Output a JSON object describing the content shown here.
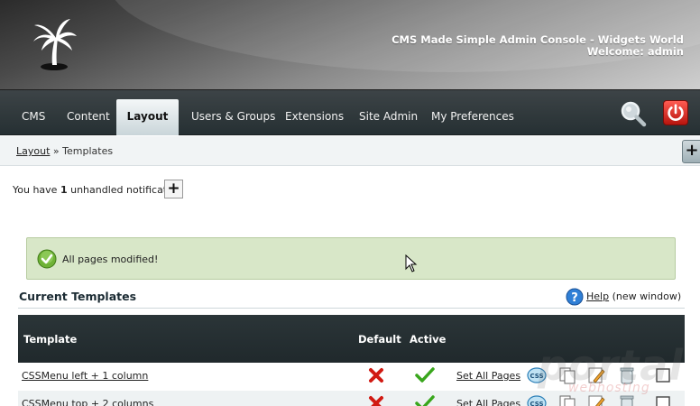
{
  "header": {
    "console_title": "CMS Made Simple Admin Console - Widgets World",
    "welcome": "Welcome: admin",
    "logo_icon": "palm-tree-logo-icon"
  },
  "nav": {
    "items": [
      {
        "label": "CMS",
        "active": false
      },
      {
        "label": "Content",
        "active": false
      },
      {
        "label": "Layout",
        "active": true
      },
      {
        "label": "Users & Groups",
        "active": false
      },
      {
        "label": "Extensions",
        "active": false
      },
      {
        "label": "Site Admin",
        "active": false
      },
      {
        "label": "My Preferences",
        "active": false
      }
    ],
    "search_icon": "magnifier-icon",
    "logout_icon": "power-icon"
  },
  "breadcrumb": {
    "parent": "Layout",
    "separator": "»",
    "current": "Templates",
    "toggle": "+"
  },
  "notification": {
    "prefix": "You have",
    "count": "1",
    "suffix": "unhandled notification",
    "expand": "+"
  },
  "message": {
    "text": "All pages modified!"
  },
  "section": {
    "title": "Current Templates",
    "help_label": "Help",
    "help_note": "(new window)"
  },
  "table": {
    "columns": {
      "template": "Template",
      "default": "Default",
      "active": "Active"
    },
    "rows": [
      {
        "name": "CSSMenu left + 1 column",
        "default": false,
        "active": true,
        "set_all": "Set All Pages"
      },
      {
        "name": "CSSMenu top + 2 columns",
        "default": false,
        "active": true,
        "set_all": "Set All Pages"
      }
    ]
  },
  "watermark": {
    "main": "portal",
    "sub": "webhosting"
  },
  "colors": {
    "nav_bg": "#263033",
    "message_bg": "#d8e7c8",
    "table_head_bg": "#20292c"
  }
}
